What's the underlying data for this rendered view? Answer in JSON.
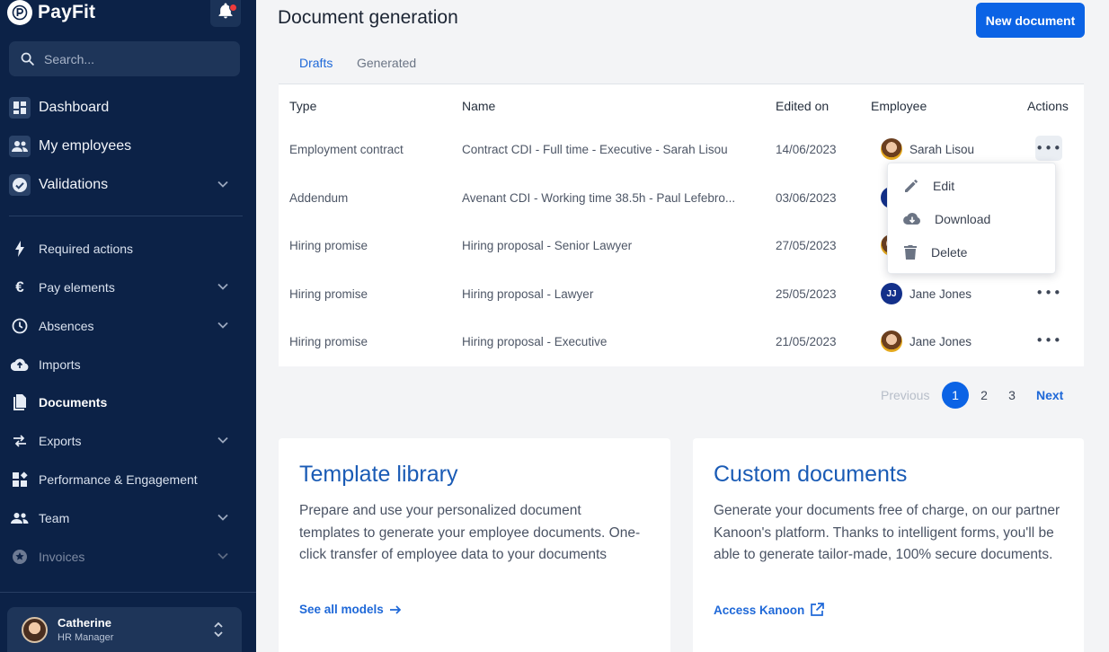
{
  "brand": {
    "name": "PayFit"
  },
  "search": {
    "placeholder": "Search..."
  },
  "nav": {
    "primary": [
      {
        "label": "Dashboard",
        "icon": "dashboard-icon"
      },
      {
        "label": "My employees",
        "icon": "people-icon"
      },
      {
        "label": "Validations",
        "icon": "check-circle-icon"
      }
    ],
    "secondary": [
      {
        "label": "Required actions",
        "icon": "bolt-icon"
      },
      {
        "label": "Pay elements",
        "icon": "euro-icon"
      },
      {
        "label": "Absences",
        "icon": "clock-icon"
      },
      {
        "label": "Imports",
        "icon": "cloud-upload-icon"
      },
      {
        "label": "Documents",
        "icon": "documents-icon"
      },
      {
        "label": "Exports",
        "icon": "swap-icon"
      },
      {
        "label": "Performance & Engagement",
        "icon": "widgets-icon"
      },
      {
        "label": "Team",
        "icon": "team-icon"
      },
      {
        "label": "Invoices",
        "icon": "invoice-icon"
      }
    ]
  },
  "user": {
    "name": "Catherine",
    "role": "HR Manager"
  },
  "page": {
    "title": "Document generation",
    "new_button": "New document"
  },
  "tabs": [
    "Drafts",
    "Generated"
  ],
  "table": {
    "headers": {
      "type": "Type",
      "name": "Name",
      "edited": "Edited on",
      "employee": "Employee",
      "actions": "Actions"
    },
    "rows": [
      {
        "type": "Employment contract",
        "name": "Contract CDI - Full time - Executive - Sarah Lisou",
        "edited": "14/06/2023",
        "employee": "Sarah Lisou"
      },
      {
        "type": "Addendum",
        "name": "Avenant CDI - Working time 38.5h - Paul Lefebro...",
        "edited": "03/06/2023",
        "employee": ""
      },
      {
        "type": "Hiring promise",
        "name": "Hiring proposal - Senior Lawyer",
        "edited": "27/05/2023",
        "employee": ""
      },
      {
        "type": "Hiring promise",
        "name": "Hiring proposal - Lawyer",
        "edited": "25/05/2023",
        "employee": "Jane Jones",
        "initials": "JJ"
      },
      {
        "type": "Hiring promise",
        "name": "Hiring proposal - Executive",
        "edited": "21/05/2023",
        "employee": "Jane Jones"
      }
    ],
    "more_glyph": "•••"
  },
  "menu": {
    "edit": "Edit",
    "download": "Download",
    "delete": "Delete"
  },
  "pagination": {
    "previous": "Previous",
    "pages": [
      "1",
      "2",
      "3"
    ],
    "next": "Next",
    "current": "1"
  },
  "cards": {
    "template": {
      "title": "Template library",
      "body": "Prepare and use your personalized document templates to generate your employee documents. One-click transfer of employee data to your documents",
      "link": "See all models"
    },
    "custom": {
      "title": "Custom documents",
      "body": "Generate your documents free of charge, on our partner Kanoon's platform. Thanks to intelligent forms, you'll be able to generate tailor-made, 100% secure documents.",
      "link": "Access Kanoon"
    }
  },
  "colors": {
    "sidebar": "#0c2247",
    "accent": "#0b63e5",
    "notification": "#ef3b3b"
  }
}
